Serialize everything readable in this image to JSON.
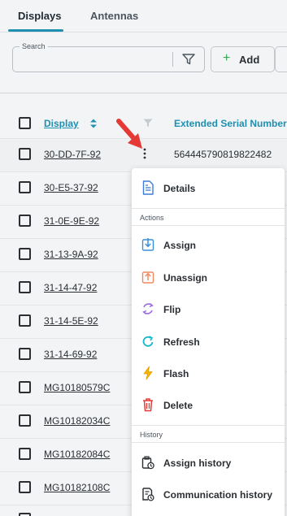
{
  "tabs": [
    {
      "label": "Displays",
      "active": true
    },
    {
      "label": "Antennas",
      "active": false
    }
  ],
  "toolbar": {
    "search_label": "Search",
    "search_value": "",
    "add_label": "Add"
  },
  "table": {
    "columns": [
      "Display",
      "Extended Serial Number"
    ],
    "rows": [
      {
        "display": "30-DD-7F-92",
        "serial": "564445790819822482"
      },
      {
        "display": "30-E5-37-92",
        "serial": ""
      },
      {
        "display": "31-0E-9E-92",
        "serial": ""
      },
      {
        "display": "31-13-9A-92",
        "serial": ""
      },
      {
        "display": "31-14-47-92",
        "serial": ""
      },
      {
        "display": "31-14-5E-92",
        "serial": ""
      },
      {
        "display": "31-14-69-92",
        "serial": ""
      },
      {
        "display": "MG10180579C",
        "serial": ""
      },
      {
        "display": "MG10182034C",
        "serial": ""
      },
      {
        "display": "MG10182084C",
        "serial": ""
      },
      {
        "display": "MG10182108C",
        "serial": ""
      }
    ]
  },
  "menu": {
    "details_label": "Details",
    "actions_section": "Actions",
    "assign_label": "Assign",
    "unassign_label": "Unassign",
    "flip_label": "Flip",
    "refresh_label": "Refresh",
    "flash_label": "Flash",
    "delete_label": "Delete",
    "history_section": "History",
    "assign_history_label": "Assign history",
    "communication_history_label": "Communication history"
  },
  "colors": {
    "accent": "#1f8fb0",
    "add_plus": "#36a853",
    "arrow": "#e53935",
    "details_icon": "#3b7dd8",
    "assign_icon": "#3b8fd8",
    "unassign_icon": "#f08a5d",
    "flip_icon": "#9b6be0",
    "refresh_icon": "#14b8c9",
    "flash_icon": "#f5b400",
    "delete_icon": "#e53935"
  },
  "icons": {
    "filter": "filter-icon",
    "sort": "sort-icon",
    "row_menu": "kebab-menu-icon",
    "pointer": "red-arrow-icon",
    "details": "document-icon",
    "assign": "assign-icon",
    "unassign": "unassign-icon",
    "flip": "flip-icon",
    "refresh": "refresh-icon",
    "flash": "lightning-icon",
    "delete": "trash-icon",
    "assign_history": "history-clock-icon",
    "communication_history": "communication-history-icon"
  }
}
